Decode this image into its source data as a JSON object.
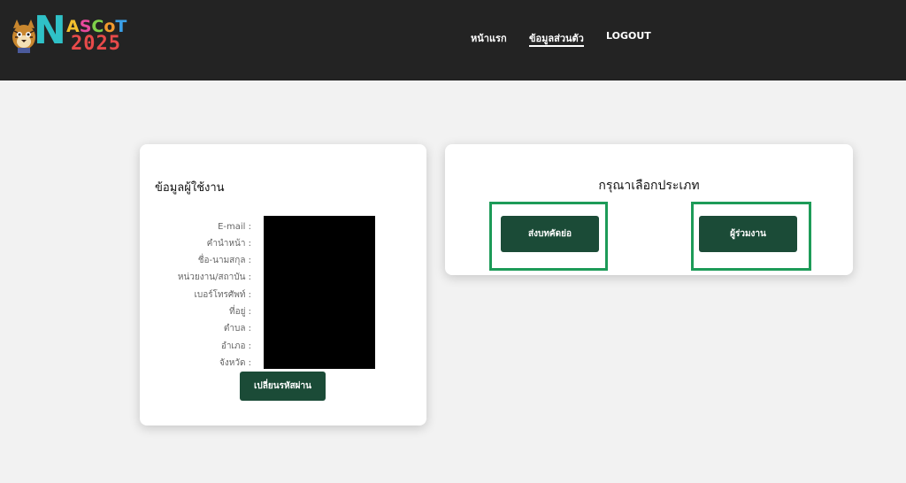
{
  "header": {
    "logo": {
      "letter_n": "N",
      "ascot": [
        "A",
        "S",
        "C",
        "o",
        "T"
      ],
      "year": "2025"
    },
    "nav": [
      {
        "label": "หน้าแรก",
        "active": false
      },
      {
        "label": "ข้อมูลส่วนตัว",
        "active": true
      },
      {
        "label": "LOGOUT",
        "active": false
      }
    ]
  },
  "user_card": {
    "title": "ข้อมูลผู้ใช้งาน",
    "fields": [
      {
        "label": "E-mail :"
      },
      {
        "label": "คำนำหน้า :"
      },
      {
        "label": "ชื่อ-นามสกุล :"
      },
      {
        "label": "หน่วยงาน/สถาบัน :"
      },
      {
        "label": "เบอร์โทรศัพท์ :"
      },
      {
        "label": "ที่อยู่ :"
      },
      {
        "label": "ตำบล :"
      },
      {
        "label": "อำเภอ :"
      },
      {
        "label": "จังหวัด :"
      }
    ],
    "change_password_label": "เปลี่ยนรหัสผ่าน"
  },
  "type_card": {
    "title": "กรุณาเลือกประเภท",
    "abstract_button_label": "ส่งบทคัดย่อ",
    "participant_button_label": "ผู้ร่วมงาน"
  },
  "colors": {
    "header_bg": "#232323",
    "button_bg": "#1b4b37",
    "highlight_border": "#1d9b58",
    "logo_n": "#2fc1c7",
    "logo_year": "#e84a4a"
  },
  "icons": {
    "logo_mascot": "tiger-mascot-icon"
  }
}
